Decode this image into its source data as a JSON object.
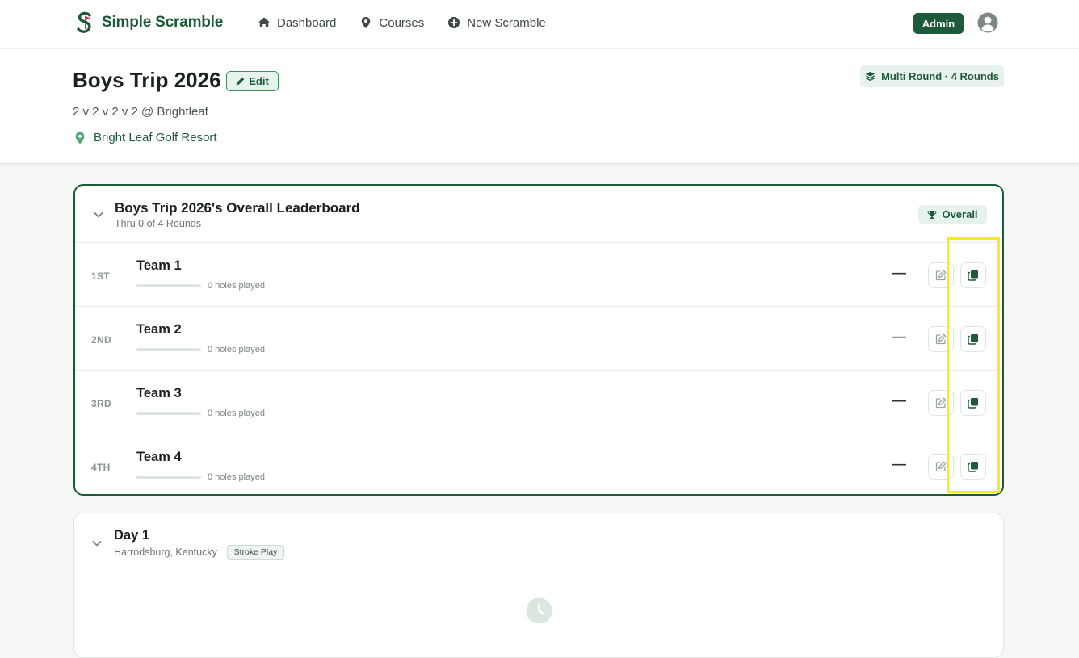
{
  "app": {
    "brand_name": "Simple Scramble"
  },
  "nav": {
    "links": [
      {
        "label": "Dashboard",
        "icon": "home-icon"
      },
      {
        "label": "Courses",
        "icon": "map-pin-icon"
      },
      {
        "label": "New Scramble",
        "icon": "plus-circle-icon"
      }
    ],
    "admin_label": "Admin"
  },
  "event": {
    "title": "Boys Trip 2026",
    "edit_label": "Edit",
    "subtitle": "2 v 2 v 2 v 2 @ Brightleaf",
    "location": "Bright Leaf Golf Resort",
    "mode_badge": "Multi Round · 4 Rounds"
  },
  "leaderboard": {
    "title": "Boys Trip 2026's Overall Leaderboard",
    "subtitle": "Thru 0 of 4 Rounds",
    "badge": "Overall",
    "teams": [
      {
        "rank": "1ST",
        "name": "Team 1",
        "holes_text": "0 holes played",
        "progress": 0,
        "score": "—"
      },
      {
        "rank": "2ND",
        "name": "Team 2",
        "holes_text": "0 holes played",
        "progress": 0,
        "score": "—"
      },
      {
        "rank": "3RD",
        "name": "Team 3",
        "holes_text": "0 holes played",
        "progress": 0,
        "score": "—"
      },
      {
        "rank": "4TH",
        "name": "Team 4",
        "holes_text": "0 holes played",
        "progress": 0,
        "score": "—"
      }
    ]
  },
  "rounds": [
    {
      "title": "Day 1",
      "location": "Harrodsburg, Kentucky",
      "format": "Stroke Play"
    }
  ],
  "colors": {
    "brand": "#1c5a3a",
    "highlight": "#f4ec1c"
  }
}
